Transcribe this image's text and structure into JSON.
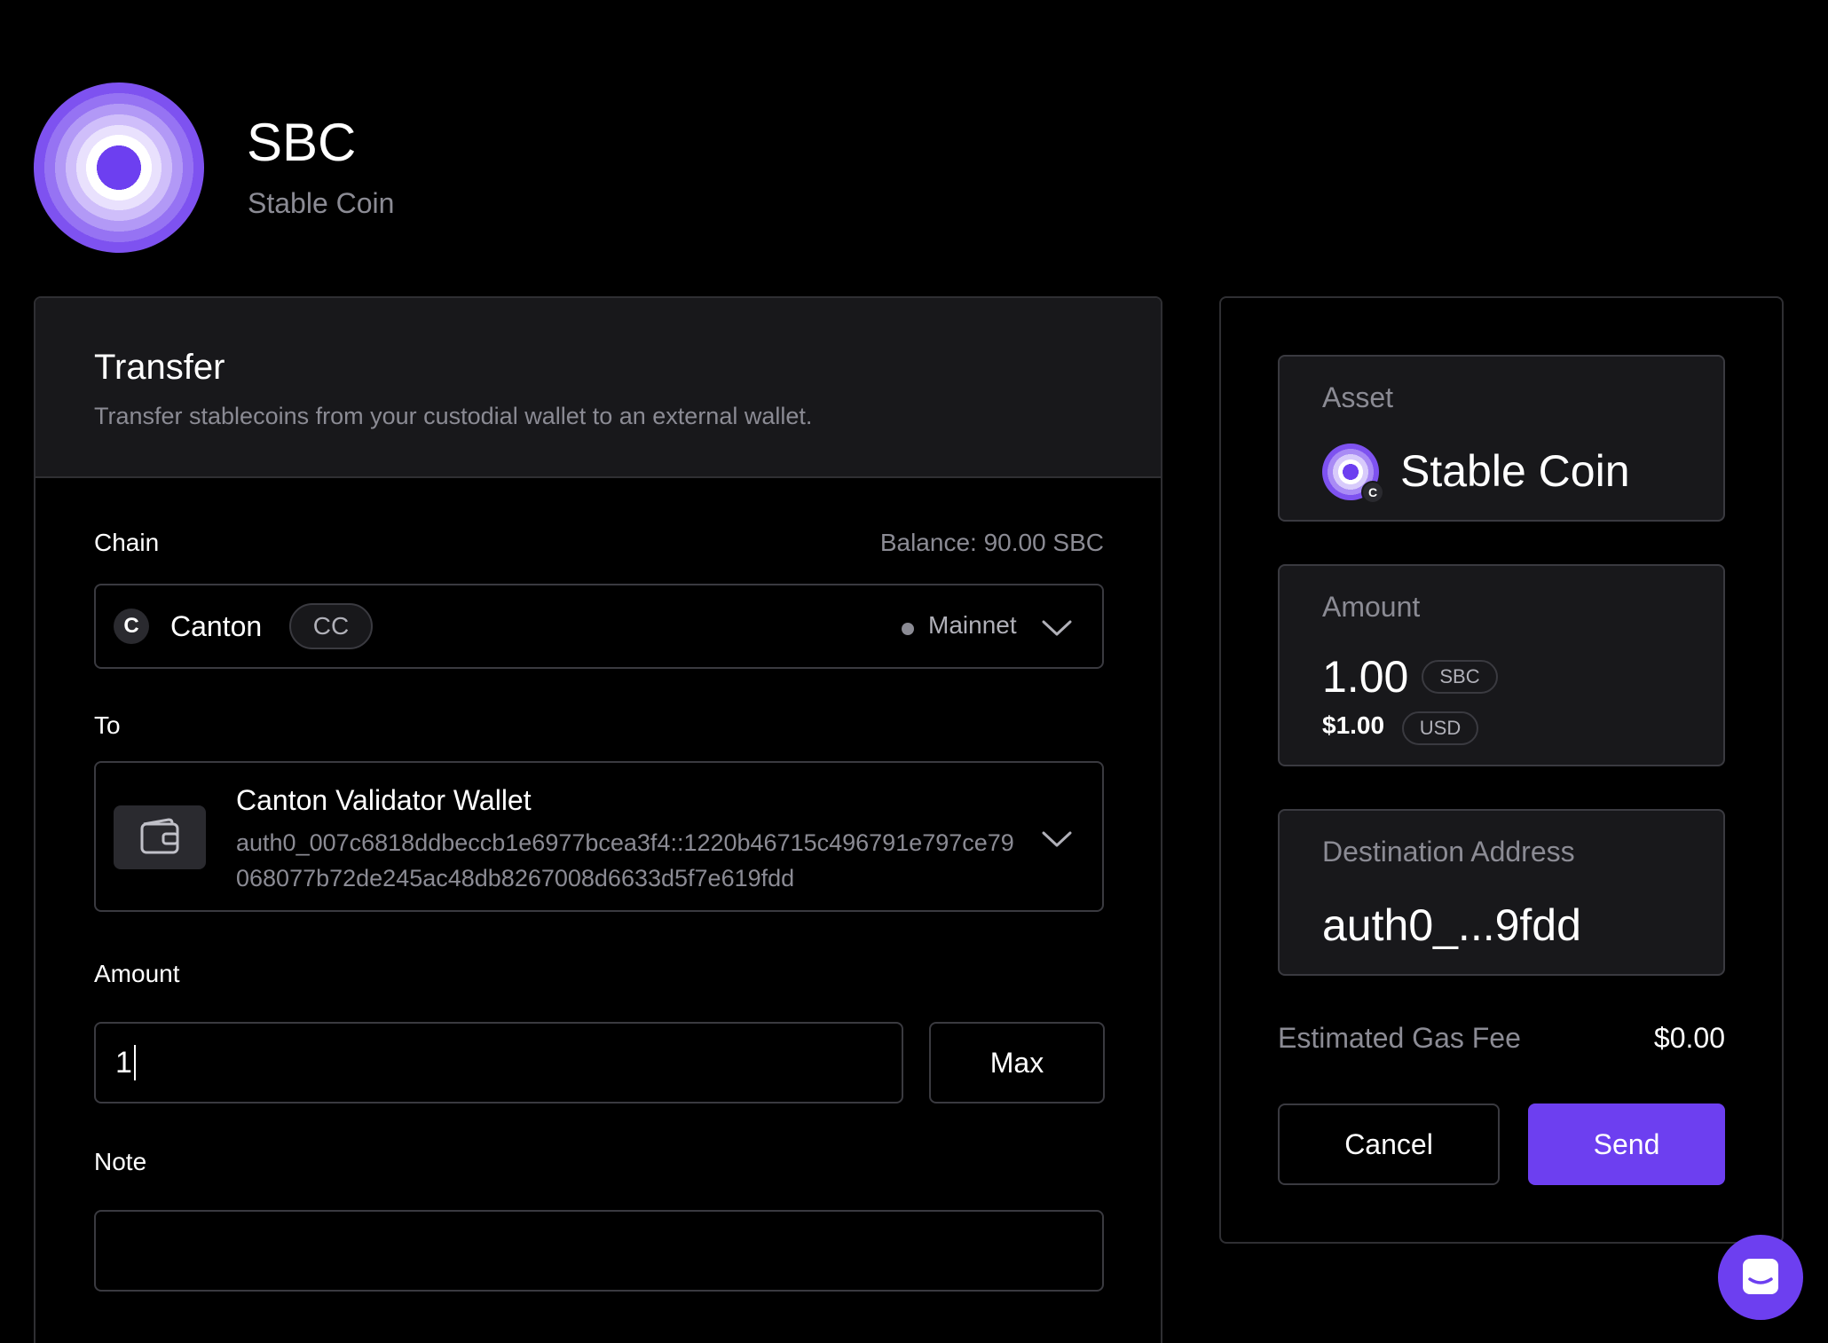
{
  "header": {
    "title": "SBC",
    "subtitle": "Stable Coin"
  },
  "transfer": {
    "title": "Transfer",
    "description": "Transfer stablecoins from your custodial wallet to an external wallet.",
    "chain": {
      "label": "Chain",
      "balance": "Balance: 90.00 SBC",
      "icon_letter": "C",
      "name": "Canton",
      "ticker": "CC",
      "network": "Mainnet"
    },
    "to": {
      "label": "To",
      "wallet_name": "Canton Validator Wallet",
      "wallet_address": "auth0_007c6818ddbeccb1e6977bcea3f4::1220b46715c496791e797ce79068077b72de245ac48db8267008d6633d5f7e619fdd"
    },
    "amount": {
      "label": "Amount",
      "value": "1",
      "max_label": "Max"
    },
    "note": {
      "label": "Note",
      "value": ""
    }
  },
  "summary": {
    "asset": {
      "label": "Asset",
      "name": "Stable Coin",
      "badge_letter": "C"
    },
    "amount": {
      "label": "Amount",
      "value": "1.00",
      "unit": "SBC",
      "usd_value": "$1.00",
      "usd_unit": "USD"
    },
    "destination": {
      "label": "Destination Address",
      "value": "auth0_...9fdd"
    },
    "gas": {
      "label": "Estimated Gas Fee",
      "value": "$0.00"
    },
    "cancel_label": "Cancel",
    "send_label": "Send"
  },
  "colors": {
    "accent": "#6d3ff0",
    "background": "#000000",
    "card_header": "#18181b",
    "muted_text": "#8b8b94"
  },
  "icons": [
    "sbc-logo-icon",
    "canton-icon",
    "chevron-down-icon",
    "wallet-icon",
    "chat-icon"
  ]
}
